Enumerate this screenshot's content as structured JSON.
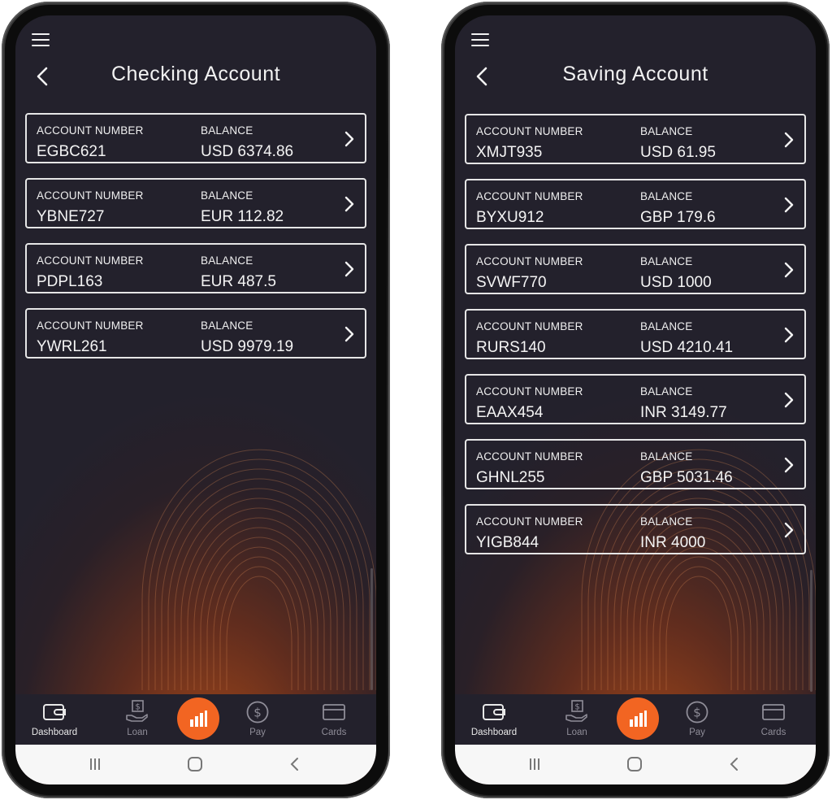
{
  "phones": [
    {
      "title": "Checking Account",
      "accounts": [
        {
          "number_label": "ACCOUNT NUMBER",
          "number": "EGBC621",
          "balance_label": "BALANCE",
          "balance": "USD 6374.86"
        },
        {
          "number_label": "ACCOUNT NUMBER",
          "number": "YBNE727",
          "balance_label": "BALANCE",
          "balance": "EUR 112.82"
        },
        {
          "number_label": "ACCOUNT NUMBER",
          "number": "PDPL163",
          "balance_label": "BALANCE",
          "balance": "EUR 487.5"
        },
        {
          "number_label": "ACCOUNT NUMBER",
          "number": "YWRL261",
          "balance_label": "BALANCE",
          "balance": "USD 9979.19"
        }
      ],
      "tabs": {
        "dashboard": "Dashboard",
        "loan": "Loan",
        "pay": "Pay",
        "cards": "Cards"
      }
    },
    {
      "title": "Saving Account",
      "accounts": [
        {
          "number_label": "ACCOUNT NUMBER",
          "number": "XMJT935",
          "balance_label": "BALANCE",
          "balance": "USD 61.95"
        },
        {
          "number_label": "ACCOUNT NUMBER",
          "number": "BYXU912",
          "balance_label": "BALANCE",
          "balance": "GBP 179.6"
        },
        {
          "number_label": "ACCOUNT NUMBER",
          "number": "SVWF770",
          "balance_label": "BALANCE",
          "balance": "USD 1000"
        },
        {
          "number_label": "ACCOUNT NUMBER",
          "number": "RURS140",
          "balance_label": "BALANCE",
          "balance": "USD 4210.41"
        },
        {
          "number_label": "ACCOUNT NUMBER",
          "number": "EAAX454",
          "balance_label": "BALANCE",
          "balance": "INR 3149.77"
        },
        {
          "number_label": "ACCOUNT NUMBER",
          "number": "GHNL255",
          "balance_label": "BALANCE",
          "balance": "GBP 5031.46"
        },
        {
          "number_label": "ACCOUNT NUMBER",
          "number": "YIGB844",
          "balance_label": "BALANCE",
          "balance": "INR 4000"
        }
      ],
      "tabs": {
        "dashboard": "Dashboard",
        "loan": "Loan",
        "pay": "Pay",
        "cards": "Cards"
      }
    }
  ],
  "icons": [
    "menu-icon",
    "back-chevron-icon",
    "chevron-right-icon",
    "wallet-icon",
    "loan-hand-icon",
    "bar-chart-icon",
    "dollar-circle-icon",
    "card-icon",
    "recent-apps-icon",
    "home-icon",
    "back-icon"
  ],
  "colors": {
    "background": "#23212c",
    "accent": "#f26522",
    "glow": "#d65814",
    "text": "#f2f2f2",
    "tab_inactive": "#8f8d98"
  }
}
